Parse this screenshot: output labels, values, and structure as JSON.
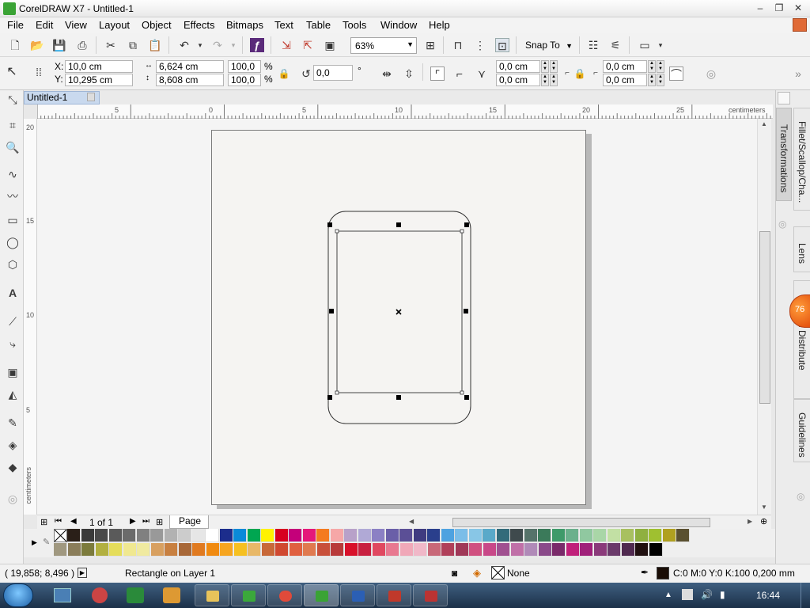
{
  "window": {
    "title": "CorelDRAW X7 - Untitled-1"
  },
  "menu": [
    "File",
    "Edit",
    "View",
    "Layout",
    "Object",
    "Effects",
    "Bitmaps",
    "Text",
    "Table",
    "Tools",
    "Window",
    "Help"
  ],
  "toolbar": {
    "zoom": "63%",
    "snap_to": "Snap To"
  },
  "propbar": {
    "x_label": "X:",
    "x": "10,0 cm",
    "y_label": "Y:",
    "y": "10,295 cm",
    "w": "6,624 cm",
    "h": "8,608 cm",
    "sx": "100,0",
    "sy": "100,0",
    "pct": "%",
    "angle": "0,0",
    "deg": "°",
    "corner1": "0,0 cm",
    "corner2": "0,0 cm",
    "corner3": "0,0 cm",
    "corner4": "0,0 cm"
  },
  "doc_tab": "Untitled-1",
  "ruler": {
    "unit": "centimeters",
    "h_labels": [
      "5",
      "0",
      "5",
      "10",
      "15",
      "20",
      "25"
    ],
    "v_labels": [
      "20",
      "15",
      "10",
      "5"
    ],
    "v_unit": "centimeters"
  },
  "pages": {
    "count": "1 of 1",
    "tab": "Page 1"
  },
  "dockers": [
    "Transformations",
    "Fillet/Scallop/Cha...",
    "Lens",
    "d Distribute",
    "Guidelines"
  ],
  "badge": "76",
  "status": {
    "coords": "( 19,858; 8,496 )",
    "selection": "Rectangle on Layer 1",
    "fill": "None",
    "outline": "C:0 M:0 Y:0 K:100  0,200 mm"
  },
  "taskbar": {
    "time": "16:44"
  },
  "palette_row1": [
    "#ffffff",
    "#2a1f18",
    "#3a3a3a",
    "#4a4a4a",
    "#5a5a5a",
    "#6b6b6b",
    "#808080",
    "#999999",
    "#b2b2b2",
    "#cccccc",
    "#e6e6e6",
    "#ffffff",
    "#1c2d8c",
    "#0a8ad8",
    "#00a651",
    "#fff200",
    "#d7001f",
    "#c4007a",
    "#e5187a",
    "#f47b20",
    "#f6a7a7",
    "#b8a1c9",
    "#b0a9d6",
    "#8b80c4",
    "#6a5fa8",
    "#5b4f96",
    "#3f3b80",
    "#2a3f8c",
    "#4ea2e0",
    "#7bbde8",
    "#88c6e6",
    "#5aa9c9",
    "#336b7a",
    "#3f4a4d",
    "#56736a",
    "#3b7a5a",
    "#3f9a6a",
    "#6bb08c",
    "#90c8a0",
    "#a9d6a7",
    "#c2e0a4",
    "#a8c060",
    "#8fb040",
    "#9fc030",
    "#b0a020",
    "#5a5030"
  ],
  "palette_row2": [
    "#a09880",
    "#8a7d5a",
    "#7c7b3c",
    "#b2b040",
    "#e5dd5a",
    "#f0e890",
    "#f0eaa0",
    "#d8a060",
    "#c88040",
    "#a86838",
    "#e07a20",
    "#f08a10",
    "#f6a520",
    "#f6c020",
    "#e8b868",
    "#c86838",
    "#d04830",
    "#e06040",
    "#e07a50",
    "#c8503a",
    "#b83a3a",
    "#d8102a",
    "#c82040",
    "#e04860",
    "#e87890",
    "#f0a8b8",
    "#f0b8c8",
    "#c86878",
    "#b0405a",
    "#a03858",
    "#d05080",
    "#c84888",
    "#a05090",
    "#c070a8",
    "#b08ab8",
    "#8a4a8a",
    "#7a2a6a",
    "#c0207a",
    "#a0207a",
    "#8a3a7a",
    "#6a3a6a",
    "#502a50",
    "#201010",
    "#000000"
  ]
}
